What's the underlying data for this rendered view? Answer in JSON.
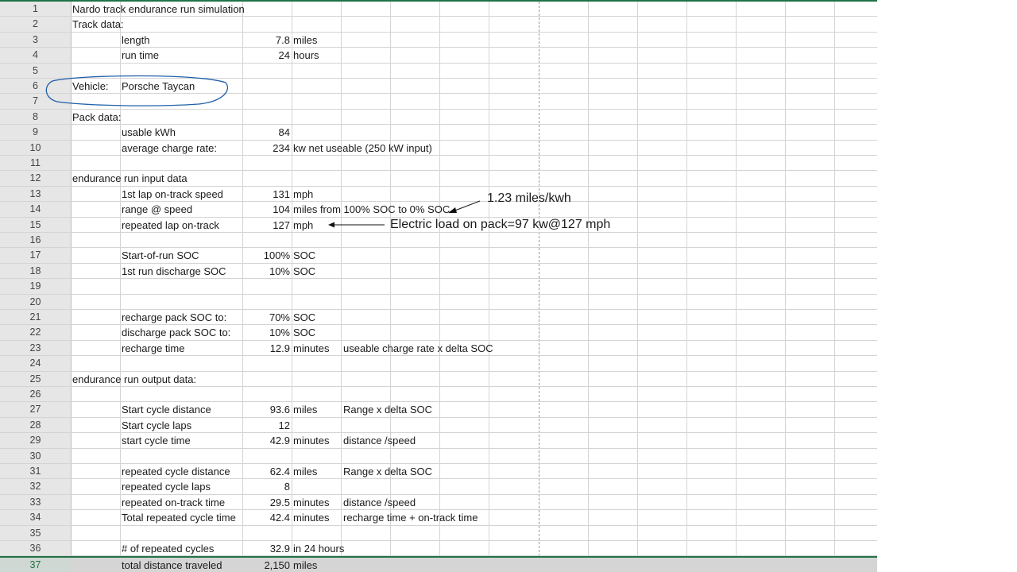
{
  "rows": [
    {
      "n": "1",
      "a": "Nardo track endurance run simulation",
      "b": "",
      "c": "",
      "d": "",
      "e": ""
    },
    {
      "n": "2",
      "a": "Track data:",
      "b": "",
      "c": "",
      "d": "",
      "e": ""
    },
    {
      "n": "3",
      "a": "",
      "b": "length",
      "c": "7.8",
      "d": "miles",
      "e": ""
    },
    {
      "n": "4",
      "a": "",
      "b": "run time",
      "c": "24",
      "d": "hours",
      "e": ""
    },
    {
      "n": "5",
      "a": "",
      "b": "",
      "c": "",
      "d": "",
      "e": ""
    },
    {
      "n": "6",
      "a": "Vehicle:",
      "b": "Porsche Taycan",
      "c": "",
      "d": "",
      "e": ""
    },
    {
      "n": "7",
      "a": "",
      "b": "",
      "c": "",
      "d": "",
      "e": ""
    },
    {
      "n": "8",
      "a": "Pack data:",
      "b": "",
      "c": "",
      "d": "",
      "e": ""
    },
    {
      "n": "9",
      "a": "",
      "b": "usable kWh",
      "c": "84",
      "d": "",
      "e": ""
    },
    {
      "n": "10",
      "a": "",
      "b": "average charge rate:",
      "c": "234",
      "d": "kw net useable (250 kW input)",
      "e": ""
    },
    {
      "n": "11",
      "a": "",
      "b": "",
      "c": "",
      "d": "",
      "e": ""
    },
    {
      "n": "12",
      "a": "endurance run input data",
      "b": "",
      "c": "",
      "d": "",
      "e": ""
    },
    {
      "n": "13",
      "a": "",
      "b": "1st lap on-track speed",
      "c": "131",
      "d": "mph",
      "e": ""
    },
    {
      "n": "14",
      "a": "",
      "b": "range @ speed",
      "c": "104",
      "d": "miles from 100% SOC to 0% SOC",
      "e": ""
    },
    {
      "n": "15",
      "a": "",
      "b": "repeated lap on-track",
      "c": "127",
      "d": "mph",
      "e": ""
    },
    {
      "n": "16",
      "a": "",
      "b": "",
      "c": "",
      "d": "",
      "e": ""
    },
    {
      "n": "17",
      "a": "",
      "b": "Start-of-run SOC",
      "c": "100%",
      "d": "SOC",
      "e": ""
    },
    {
      "n": "18",
      "a": "",
      "b": "1st run  discharge SOC",
      "c": "10%",
      "d": "SOC",
      "e": ""
    },
    {
      "n": "19",
      "a": "",
      "b": "",
      "c": "",
      "d": "",
      "e": ""
    },
    {
      "n": "20",
      "a": "",
      "b": "",
      "c": "",
      "d": "",
      "e": ""
    },
    {
      "n": "21",
      "a": "",
      "b": "recharge pack SOC to:",
      "c": "70%",
      "d": "SOC",
      "e": ""
    },
    {
      "n": "22",
      "a": "",
      "b": "discharge pack SOC to:",
      "c": "10%",
      "d": "SOC",
      "e": ""
    },
    {
      "n": "23",
      "a": "",
      "b": "recharge time",
      "c": "12.9",
      "d": "minutes",
      "e": "useable charge rate x delta SOC"
    },
    {
      "n": "24",
      "a": "",
      "b": "",
      "c": "",
      "d": "",
      "e": ""
    },
    {
      "n": "25",
      "a": "endurance run output data:",
      "b": "",
      "c": "",
      "d": "",
      "e": ""
    },
    {
      "n": "26",
      "a": "",
      "b": "",
      "c": "",
      "d": "",
      "e": ""
    },
    {
      "n": "27",
      "a": "",
      "b": "Start cycle distance",
      "c": "93.6",
      "d": "miles",
      "e": "Range x delta SOC"
    },
    {
      "n": "28",
      "a": "",
      "b": "Start cycle laps",
      "c": "12",
      "d": "",
      "e": ""
    },
    {
      "n": "29",
      "a": "",
      "b": "start cycle time",
      "c": "42.9",
      "d": "minutes",
      "e": "distance /speed"
    },
    {
      "n": "30",
      "a": "",
      "b": "",
      "c": "",
      "d": "",
      "e": ""
    },
    {
      "n": "31",
      "a": "",
      "b": "repeated cycle distance",
      "c": "62.4",
      "d": "miles",
      "e": "Range x delta SOC"
    },
    {
      "n": "32",
      "a": "",
      "b": "repeated cycle laps",
      "c": "8",
      "d": "",
      "e": ""
    },
    {
      "n": "33",
      "a": "",
      "b": "repeated on-track time",
      "c": "29.5",
      "d": "minutes",
      "e": "distance /speed"
    },
    {
      "n": "34",
      "a": "",
      "b": "Total repeated cycle time",
      "c": "42.4",
      "d": "minutes",
      "e": "recharge time + on-track time"
    },
    {
      "n": "35",
      "a": "",
      "b": "",
      "c": "",
      "d": "",
      "e": ""
    },
    {
      "n": "36",
      "a": "",
      "b": "# of repeated cycles",
      "c": "32.9",
      "d": "in 24 hours",
      "e": ""
    },
    {
      "n": "37",
      "a": "",
      "b": "total distance traveled",
      "c": "2,150",
      "d": "miles",
      "e": ""
    }
  ],
  "annotations": {
    "efficiency_note": "1.23 miles/kwh",
    "load_note": "Electric load on pack=97 kw@127 mph"
  },
  "colors": {
    "grid": "#d4d4d4",
    "header_bg": "#e6e6e6",
    "selection_border": "#217346",
    "selected_row_bg": "#d5d5d5",
    "circle_annotation": "#1f5fa8"
  }
}
